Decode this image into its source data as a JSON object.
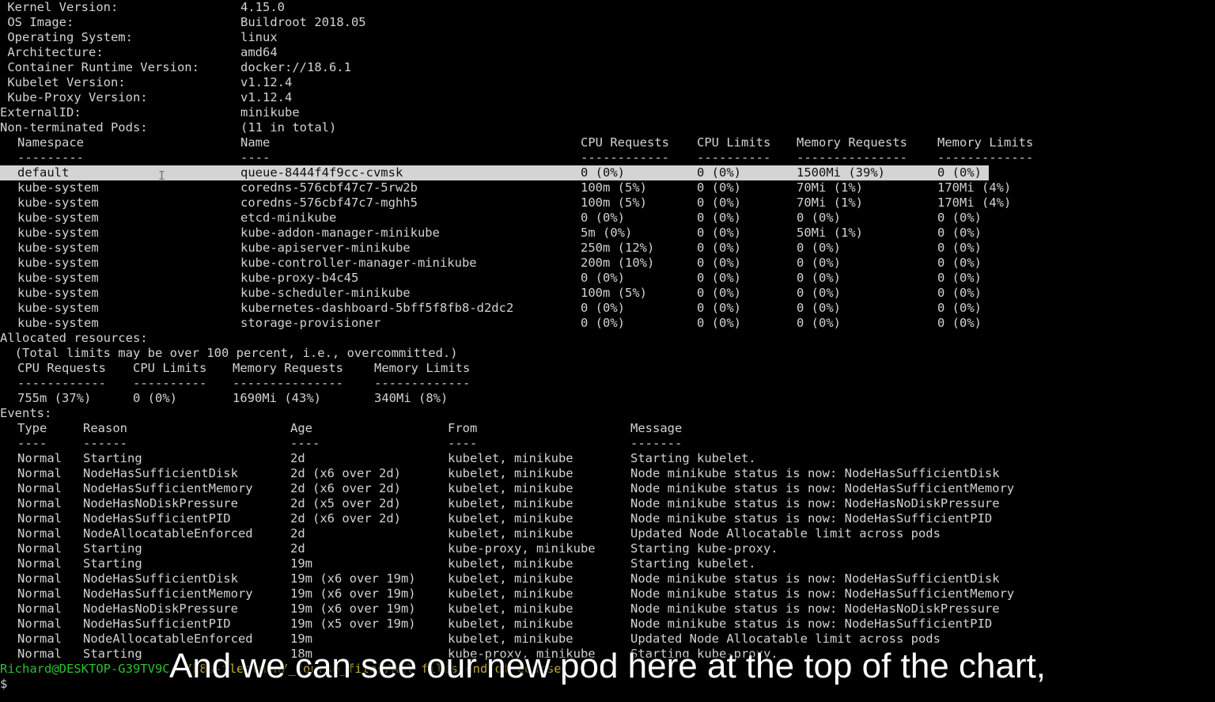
{
  "node_info": [
    {
      "label": " Kernel Version:",
      "value": "4.15.0"
    },
    {
      "label": " OS Image:",
      "value": "Buildroot 2018.05"
    },
    {
      "label": " Operating System:",
      "value": "linux"
    },
    {
      "label": " Architecture:",
      "value": "amd64"
    },
    {
      "label": " Container Runtime Version:",
      "value": "docker://18.6.1"
    },
    {
      "label": " Kubelet Version:",
      "value": "v1.12.4"
    },
    {
      "label": " Kube-Proxy Version:",
      "value": "v1.12.4"
    },
    {
      "label": "ExternalID:",
      "value": "minikube"
    },
    {
      "label": "Non-terminated Pods:",
      "value": "(11 in total)"
    }
  ],
  "pods": {
    "headers": [
      "Namespace",
      "Name",
      "CPU Requests",
      "CPU Limits",
      "Memory Requests",
      "Memory Limits"
    ],
    "underlines": [
      "---------",
      "----",
      "------------",
      "----------",
      "---------------",
      "-------------"
    ],
    "highlighted_row_index": 0,
    "rows": [
      [
        "default",
        "queue-8444f4f9cc-cvmsk",
        "0 (0%)",
        "0 (0%)",
        "1500Mi (39%)",
        "0 (0%)"
      ],
      [
        "kube-system",
        "coredns-576cbf47c7-5rw2b",
        "100m (5%)",
        "0 (0%)",
        "70Mi (1%)",
        "170Mi (4%)"
      ],
      [
        "kube-system",
        "coredns-576cbf47c7-mghh5",
        "100m (5%)",
        "0 (0%)",
        "70Mi (1%)",
        "170Mi (4%)"
      ],
      [
        "kube-system",
        "etcd-minikube",
        "0 (0%)",
        "0 (0%)",
        "0 (0%)",
        "0 (0%)"
      ],
      [
        "kube-system",
        "kube-addon-manager-minikube",
        "5m (0%)",
        "0 (0%)",
        "50Mi (1%)",
        "0 (0%)"
      ],
      [
        "kube-system",
        "kube-apiserver-minikube",
        "250m (12%)",
        "0 (0%)",
        "0 (0%)",
        "0 (0%)"
      ],
      [
        "kube-system",
        "kube-controller-manager-minikube",
        "200m (10%)",
        "0 (0%)",
        "0 (0%)",
        "0 (0%)"
      ],
      [
        "kube-system",
        "kube-proxy-b4c45",
        "0 (0%)",
        "0 (0%)",
        "0 (0%)",
        "0 (0%)"
      ],
      [
        "kube-system",
        "kube-scheduler-minikube",
        "100m (5%)",
        "0 (0%)",
        "0 (0%)",
        "0 (0%)"
      ],
      [
        "kube-system",
        "kubernetes-dashboard-5bff5f8fb8-d2dc2",
        "0 (0%)",
        "0 (0%)",
        "0 (0%)",
        "0 (0%)"
      ],
      [
        "kube-system",
        "storage-provisioner",
        "0 (0%)",
        "0 (0%)",
        "0 (0%)",
        "0 (0%)"
      ]
    ]
  },
  "allocated": {
    "title": "Allocated resources:",
    "note": "  (Total limits may be over 100 percent, i.e., overcommitted.)",
    "headers": [
      "CPU Requests",
      "CPU Limits",
      "Memory Requests",
      "Memory Limits"
    ],
    "underlines": [
      "------------",
      "----------",
      "---------------",
      "-------------"
    ],
    "values": [
      "755m (37%)",
      "0 (0%)",
      "1690Mi (43%)",
      "340Mi (8%)"
    ]
  },
  "events": {
    "title": "Events:",
    "headers": [
      "Type",
      "Reason",
      "Age",
      "From",
      "Message"
    ],
    "underlines": [
      "----",
      "------",
      "----",
      "----",
      "-------"
    ],
    "rows": [
      [
        "Normal",
        "Starting",
        "2d",
        "kubelet, minikube",
        "Starting kubelet."
      ],
      [
        "Normal",
        "NodeHasSufficientDisk",
        "2d (x6 over 2d)",
        "kubelet, minikube",
        "Node minikube status is now: NodeHasSufficientDisk"
      ],
      [
        "Normal",
        "NodeHasSufficientMemory",
        "2d (x6 over 2d)",
        "kubelet, minikube",
        "Node minikube status is now: NodeHasSufficientMemory"
      ],
      [
        "Normal",
        "NodeHasNoDiskPressure",
        "2d (x5 over 2d)",
        "kubelet, minikube",
        "Node minikube status is now: NodeHasNoDiskPressure"
      ],
      [
        "Normal",
        "NodeHasSufficientPID",
        "2d (x6 over 2d)",
        "kubelet, minikube",
        "Node minikube status is now: NodeHasSufficientPID"
      ],
      [
        "Normal",
        "NodeAllocatableEnforced",
        "2d",
        "kubelet, minikube",
        "Updated Node Allocatable limit across pods"
      ],
      [
        "Normal",
        "Starting",
        "2d",
        "kube-proxy, minikube",
        "Starting kube-proxy."
      ],
      [
        "Normal",
        "Starting",
        "19m",
        "kubelet, minikube",
        "Starting kubelet."
      ],
      [
        "Normal",
        "NodeHasSufficientDisk",
        "19m (x6 over 19m)",
        "kubelet, minikube",
        "Node minikube status is now: NodeHasSufficientDisk"
      ],
      [
        "Normal",
        "NodeHasSufficientMemory",
        "19m (x6 over 19m)",
        "kubelet, minikube",
        "Node minikube status is now: NodeHasSufficientMemory"
      ],
      [
        "Normal",
        "NodeHasNoDiskPressure",
        "19m (x6 over 19m)",
        "kubelet, minikube",
        "Node minikube status is now: NodeHasNoDiskPressure"
      ],
      [
        "Normal",
        "NodeHasSufficientPID",
        "19m (x5 over 19m)",
        "kubelet, minikube",
        "Node minikube status is now: NodeHasSufficientPID"
      ],
      [
        "Normal",
        "NodeAllocatableEnforced",
        "19m",
        "kubelet, minikube",
        "Updated Node Allocatable limit across pods"
      ],
      [
        "Normal",
        "Starting",
        "18m",
        "kube-proxy, minikube",
        "Starting kube-proxy."
      ]
    ]
  },
  "prompt": {
    "user_host": "Richard@DESKTOP-G39TV9C",
    "path": " ~/k8s-fleetman/_course_files/All files end of course",
    "symbol": "$"
  },
  "subtitle": "And we can see our new pod here at the top of the chart,",
  "colors": {
    "background": "#000000",
    "text": "#d2d2d2",
    "highlight": "#d4d4d4",
    "prompt_user": "#2fbf2f",
    "prompt_path": "#c8b43c",
    "subtitle": "#ffffff"
  }
}
